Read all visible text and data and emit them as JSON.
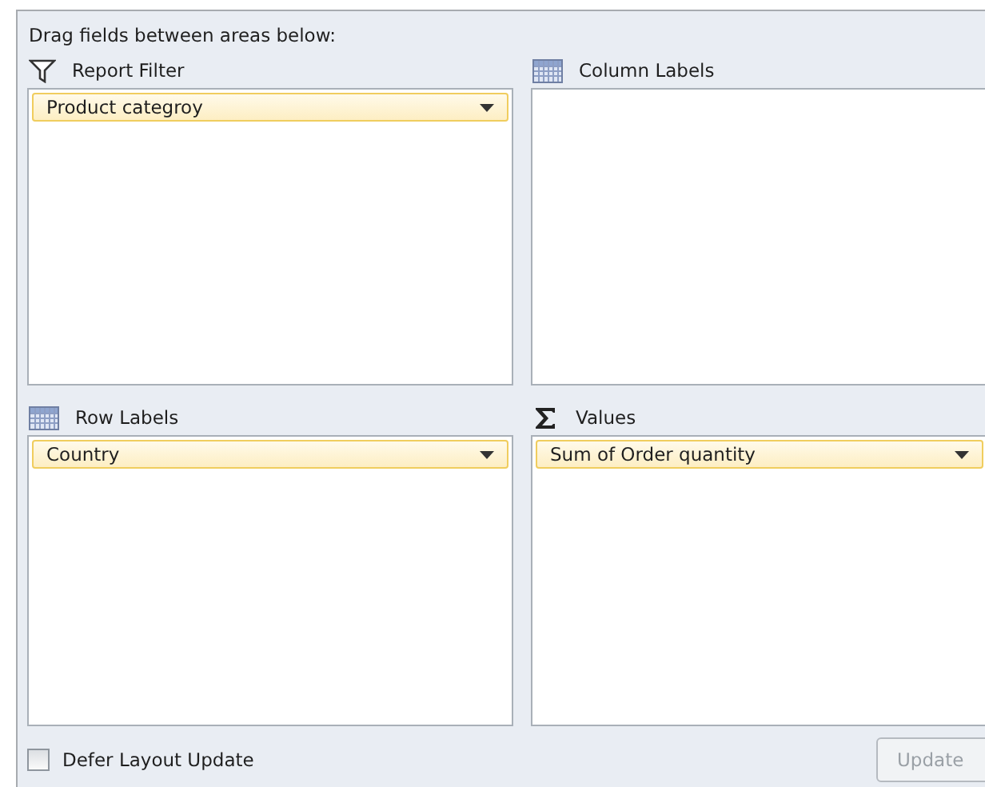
{
  "instruction": "Drag fields between areas below:",
  "areas": [
    {
      "kind": "filter",
      "title": "Report Filter",
      "fields": [
        {
          "label": "Product categroy"
        }
      ]
    },
    {
      "kind": "grid",
      "title": "Column Labels"
    },
    {
      "kind": "grid",
      "title": "Row Labels",
      "fields": [
        {
          "label": "Country"
        }
      ]
    },
    {
      "kind": "sigma",
      "title": "Values",
      "fields": [
        {
          "label": "Sum of Order quantity"
        }
      ]
    }
  ],
  "defer_checkbox": {
    "label": "Defer Layout Update",
    "checked": false
  },
  "update_button": {
    "label": "Update",
    "disabled": true
  }
}
